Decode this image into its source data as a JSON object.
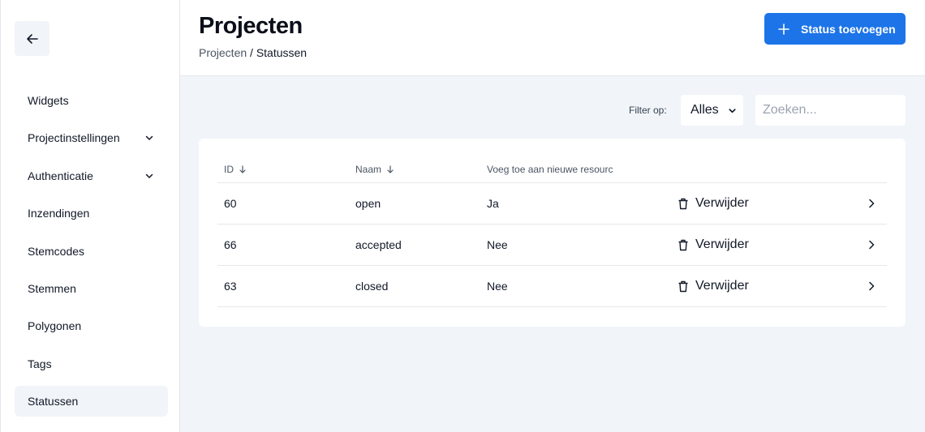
{
  "sidebar": {
    "back_icon": "arrow-left-icon",
    "items": [
      {
        "label": "Widgets",
        "has_chevron": false
      },
      {
        "label": "Projectinstellingen",
        "has_chevron": true
      },
      {
        "label": "Authenticatie",
        "has_chevron": true
      },
      {
        "label": "Inzendingen",
        "has_chevron": false
      },
      {
        "label": "Stemcodes",
        "has_chevron": false
      },
      {
        "label": "Stemmen",
        "has_chevron": false
      },
      {
        "label": "Polygonen",
        "has_chevron": false
      },
      {
        "label": "Tags",
        "has_chevron": false
      },
      {
        "label": "Statussen",
        "has_chevron": false,
        "active": true
      }
    ]
  },
  "header": {
    "title": "Projecten",
    "breadcrumb": {
      "link": "Projecten",
      "separator": "/",
      "current": "Statussen"
    },
    "add_button": {
      "label": "Status toevoegen",
      "icon": "plus-icon"
    }
  },
  "filter": {
    "label": "Filter op:",
    "select_value": "Alles",
    "search_placeholder": "Zoeken..."
  },
  "table": {
    "columns": [
      "ID",
      "Naam",
      "Voeg toe aan nieuwe resourc"
    ],
    "delete_label": "Verwijder",
    "rows": [
      {
        "id": "60",
        "name": "open",
        "add_to_new": "Ja"
      },
      {
        "id": "66",
        "name": "accepted",
        "add_to_new": "Nee"
      },
      {
        "id": "63",
        "name": "closed",
        "add_to_new": "Nee"
      }
    ]
  },
  "colors": {
    "accent": "#1d74e8",
    "background": "#f1f5f9"
  }
}
